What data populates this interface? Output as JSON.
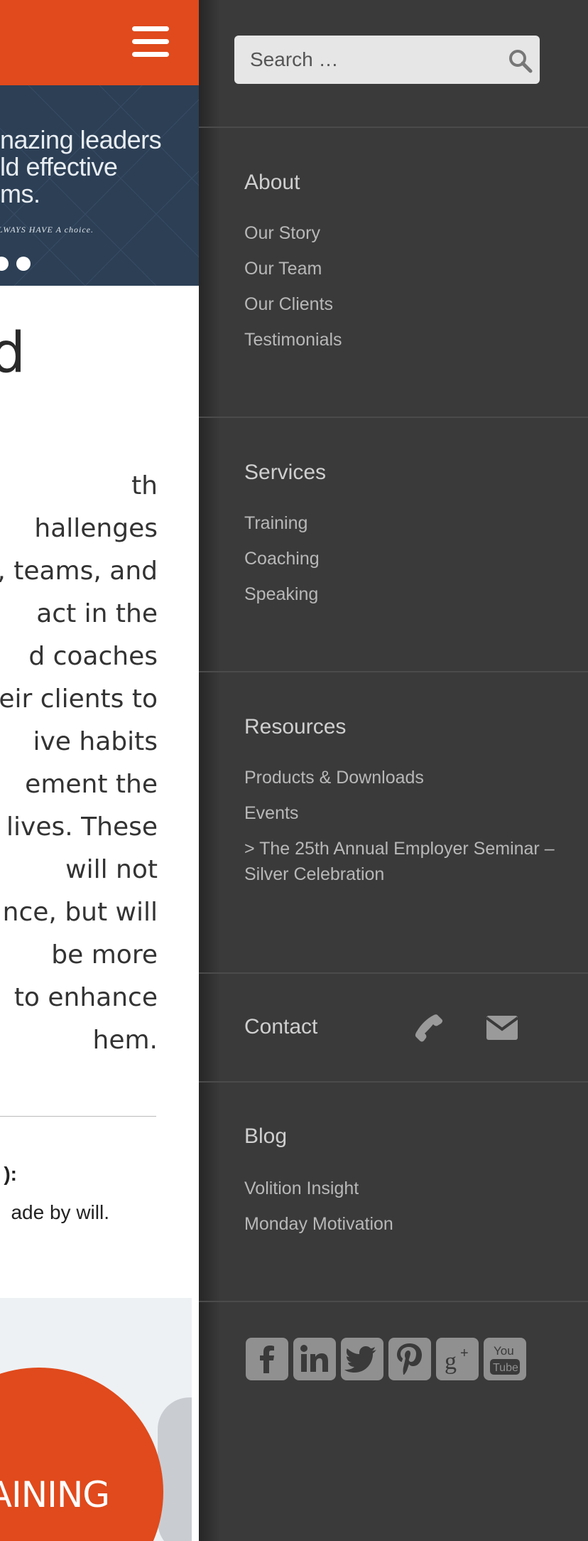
{
  "page": {
    "hero": {
      "line1": "nazing leaders",
      "line2": "ld effective",
      "line3": "ms.",
      "tagline": "LWAYS HAVE A choice."
    },
    "heading_fragment": "d",
    "paragraph_lines": [
      "th",
      "hallenges",
      ", teams, and",
      "act in the",
      "d coaches",
      "eir clients to",
      "ive habits",
      "ement the",
      "lives. These",
      " will not",
      "nce, but will",
      " be more",
      " to enhance",
      "hem."
    ],
    "quote_label": "):",
    "quote_text": "ade by will.",
    "promo_label": "TRAINING"
  },
  "drawer": {
    "search": {
      "placeholder": "Search …"
    },
    "about": {
      "title": "About",
      "links": [
        "Our Story",
        "Our Team",
        "Our Clients",
        "Testimonials"
      ]
    },
    "services": {
      "title": "Services",
      "links": [
        "Training",
        "Coaching",
        "Speaking"
      ]
    },
    "resources": {
      "title": "Resources",
      "links": [
        "Products & Downloads",
        "Events",
        "> The 25th Annual Employer Seminar –",
        "Silver Celebration"
      ]
    },
    "contact": {
      "title": "Contact",
      "icons": [
        "phone-icon",
        "mail-icon"
      ]
    },
    "blog": {
      "title": "Blog",
      "links": [
        "Volition Insight",
        "Monday Motivation"
      ]
    },
    "social": [
      "facebook",
      "linkedin",
      "twitter",
      "pinterest",
      "google-plus",
      "youtube"
    ]
  },
  "colors": {
    "brand_orange": "#e04a1c",
    "drawer_bg": "#3a3a3a",
    "hero_bg": "#2c3f55",
    "social_icon": "#909090"
  }
}
